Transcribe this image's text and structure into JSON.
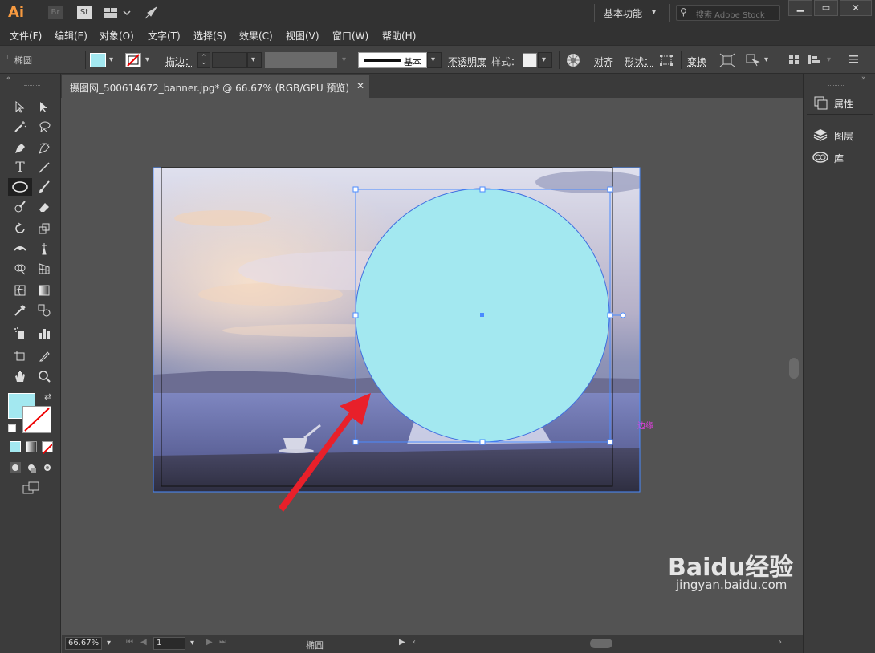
{
  "app": {
    "logo": "Ai",
    "bridge": "Br",
    "stock": "St",
    "workspace": "基本功能",
    "search_placeholder": "搜索 Adobe Stock"
  },
  "menu": [
    "文件(F)",
    "编辑(E)",
    "对象(O)",
    "文字(T)",
    "选择(S)",
    "效果(C)",
    "视图(V)",
    "窗口(W)",
    "帮助(H)"
  ],
  "control": {
    "object_type": "椭圆",
    "fill_color": "#a3e8f0",
    "stroke_label": "描边：",
    "brush_label": "基本",
    "opacity_label": "不透明度",
    "style_label": "样式：",
    "align_label": "对齐",
    "shape_label": "形状：",
    "transform_label": "变换"
  },
  "document": {
    "tab_title": "摄图网_500614672_banner.jpg* @ 66.67% (RGB/GPU 预览)"
  },
  "canvas": {
    "smart_guide": "边缘"
  },
  "panels": {
    "properties": "属性",
    "layers": "图层",
    "libraries": "库"
  },
  "status": {
    "zoom": "66.67%",
    "artboard": "1",
    "tool": "椭圆"
  },
  "colors": {
    "accent": "#4a8bff",
    "fill": "#a3e8f0",
    "arrow": "#e8202a"
  },
  "watermark": {
    "brand": "Baidu经验",
    "url": "jingyan.baidu.com"
  }
}
